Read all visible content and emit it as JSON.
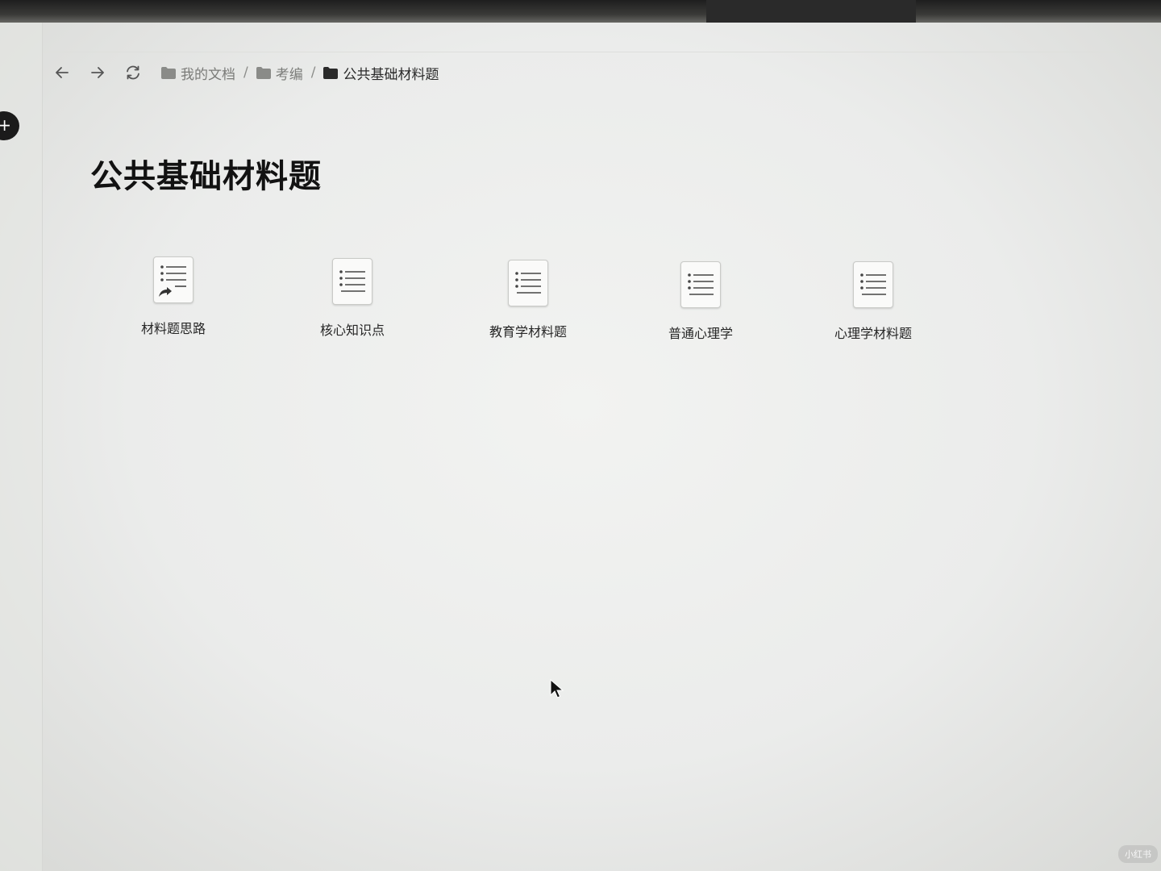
{
  "nav": {
    "back_icon": "arrow-left-icon",
    "forward_icon": "arrow-right-icon",
    "refresh_icon": "refresh-icon"
  },
  "breadcrumb": [
    {
      "label": "我的文档",
      "icon": "folder-icon"
    },
    {
      "label": "考编",
      "icon": "folder-icon"
    },
    {
      "label": "公共基础材料题",
      "icon": "folder-icon"
    }
  ],
  "breadcrumb_separator": "/",
  "add_button_label": "+",
  "page_title": "公共基础材料题",
  "files": [
    {
      "label": "材料题思路",
      "icon": "shortcut-list-document-icon"
    },
    {
      "label": "核心知识点",
      "icon": "list-document-icon"
    },
    {
      "label": "教育学材料题",
      "icon": "list-document-icon"
    },
    {
      "label": "普通心理学",
      "icon": "list-document-icon"
    },
    {
      "label": "心理学材料题",
      "icon": "list-document-icon"
    }
  ],
  "watermark": "小红书"
}
